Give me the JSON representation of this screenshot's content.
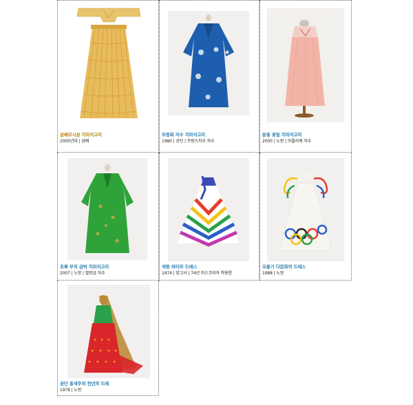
{
  "items": [
    {
      "title": "삼베모시삼 치마저고리",
      "subtitle": "2000년대 | 삼베",
      "title_color": "#b8860b"
    },
    {
      "title": "무용화 자수 치마저고리",
      "subtitle": "1980 | 공단 | 프랑스자수 자수",
      "title_color": "#2e7fb0"
    },
    {
      "title": "분홍 꽃잎 치마저고리",
      "subtitle": "2000 | 노방 | 아플리케 자수",
      "title_color": "#2e7fb0"
    },
    {
      "title": "초록 부귀 금박 치마저고리",
      "subtitle": "2007 | 노방 | 필방금 자수",
      "title_color": "#2e7fb0"
    },
    {
      "title": "색동 파티마 드레스",
      "subtitle": "1974 | 양고사 | 74년 미스코리아 착용한",
      "title_color": "#2e7fb0"
    },
    {
      "title": "오륜기 다문화의 드레스",
      "subtitle": "1988 | 노방",
      "title_color": "#2e7fb0",
      "title_suffix_color": "#b8860b"
    },
    {
      "title": "공단 홍색주의 천년의 드레",
      "subtitle": "1978 | 노방",
      "title_color": "#2e7fb0"
    }
  ]
}
